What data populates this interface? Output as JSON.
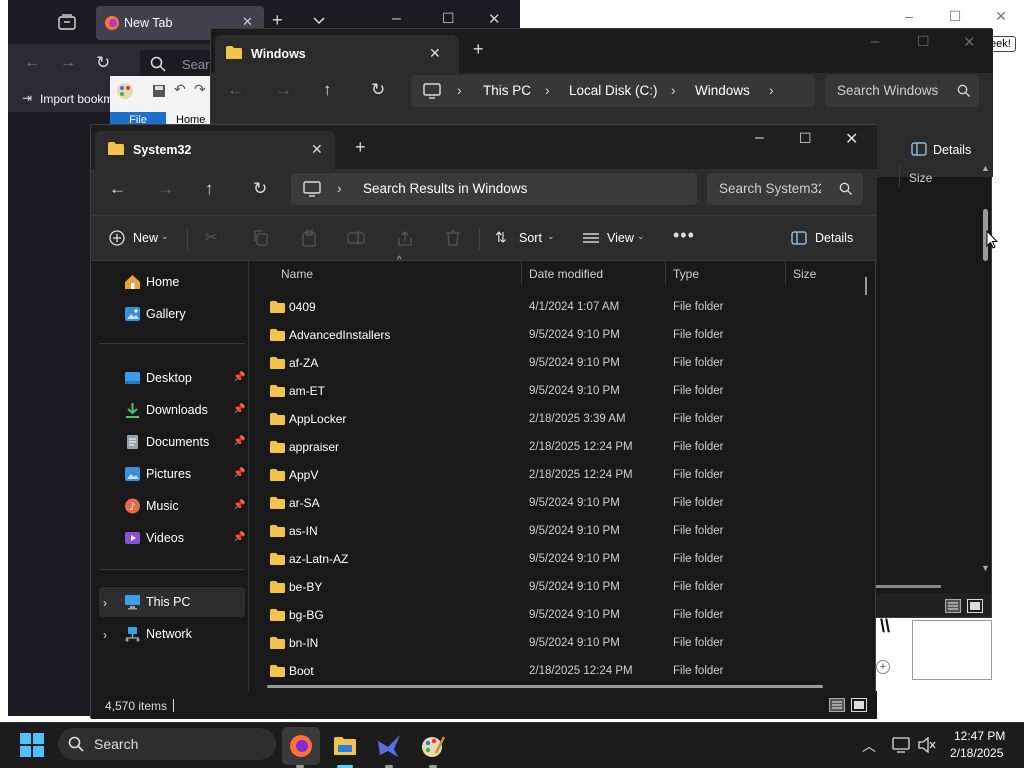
{
  "background_app": {
    "seek_label": "eek!"
  },
  "browser": {
    "tab_title": "New Tab",
    "url_placeholder": "Search",
    "bookmark_label": "Import bookm",
    "paint_file": "File",
    "paint_home": "Home"
  },
  "windows_explorer": {
    "tab_title": "Windows",
    "breadcrumb": [
      "This PC",
      "Local Disk (C:)",
      "Windows"
    ],
    "search_placeholder": "Search Windows",
    "details_label": "Details",
    "size_header": "Size"
  },
  "system32_explorer": {
    "tab_title": "System32",
    "address": "Search Results in Windows",
    "search_placeholder": "Search System32",
    "toolbar": {
      "new_label": "New",
      "sort_label": "Sort",
      "view_label": "View",
      "details_label": "Details"
    },
    "sidebar": {
      "home": "Home",
      "gallery": "Gallery",
      "desktop": "Desktop",
      "downloads": "Downloads",
      "documents": "Documents",
      "pictures": "Pictures",
      "music": "Music",
      "videos": "Videos",
      "this_pc": "This PC",
      "network": "Network"
    },
    "columns": {
      "name": "Name",
      "date": "Date modified",
      "type": "Type",
      "size": "Size"
    },
    "files": [
      {
        "name": "0409",
        "date": "4/1/2024 1:07 AM",
        "type": "File folder"
      },
      {
        "name": "AdvancedInstallers",
        "date": "9/5/2024 9:10 PM",
        "type": "File folder"
      },
      {
        "name": "af-ZA",
        "date": "9/5/2024 9:10 PM",
        "type": "File folder"
      },
      {
        "name": "am-ET",
        "date": "9/5/2024 9:10 PM",
        "type": "File folder"
      },
      {
        "name": "AppLocker",
        "date": "2/18/2025 3:39 AM",
        "type": "File folder"
      },
      {
        "name": "appraiser",
        "date": "2/18/2025 12:24 PM",
        "type": "File folder"
      },
      {
        "name": "AppV",
        "date": "2/18/2025 12:24 PM",
        "type": "File folder"
      },
      {
        "name": "ar-SA",
        "date": "9/5/2024 9:10 PM",
        "type": "File folder"
      },
      {
        "name": "as-IN",
        "date": "9/5/2024 9:10 PM",
        "type": "File folder"
      },
      {
        "name": "az-Latn-AZ",
        "date": "9/5/2024 9:10 PM",
        "type": "File folder"
      },
      {
        "name": "be-BY",
        "date": "9/5/2024 9:10 PM",
        "type": "File folder"
      },
      {
        "name": "bg-BG",
        "date": "9/5/2024 9:10 PM",
        "type": "File folder"
      },
      {
        "name": "bn-IN",
        "date": "9/5/2024 9:10 PM",
        "type": "File folder"
      },
      {
        "name": "Boot",
        "date": "2/18/2025 12:24 PM",
        "type": "File folder"
      }
    ],
    "status": "4,570 items"
  },
  "taskbar": {
    "search_placeholder": "Search",
    "time": "12:47 PM",
    "date": "2/18/2025"
  },
  "colors": {
    "folder": "#f3c44d",
    "accent": "#0078d4"
  }
}
